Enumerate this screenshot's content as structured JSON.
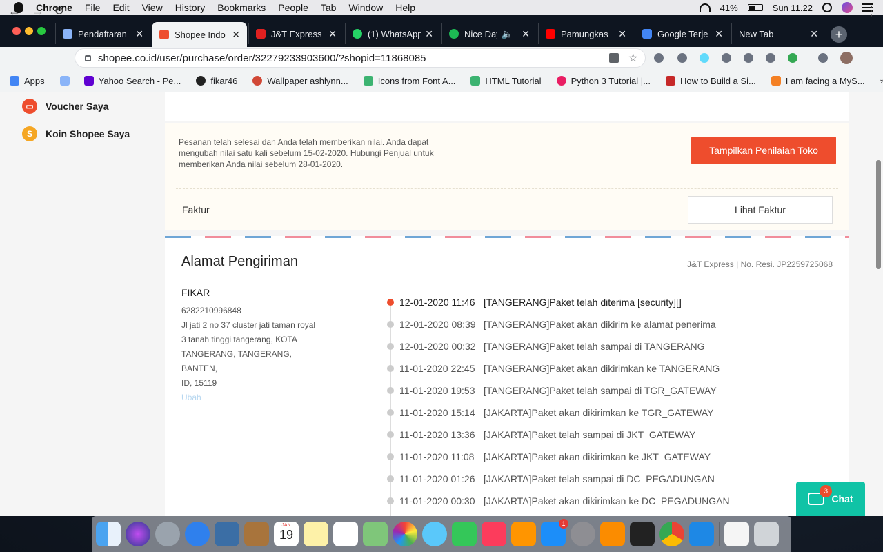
{
  "menubar": {
    "app": "Chrome",
    "menus": [
      "File",
      "Edit",
      "View",
      "History",
      "Bookmarks",
      "People",
      "Tab",
      "Window",
      "Help"
    ],
    "battery": "41%",
    "clock": "Sun 11.22"
  },
  "tabs": [
    {
      "title": "Pendaftaran",
      "color": "#8ab4f8"
    },
    {
      "title": "Shopee Indo",
      "color": "#ee4d2d"
    },
    {
      "title": "J&T Express",
      "color": "#e02020"
    },
    {
      "title": "(1) WhatsApp",
      "color": "#25d366"
    },
    {
      "title": "Nice Day",
      "color": "#1db954"
    },
    {
      "title": "Pamungkas",
      "color": "#ff0000"
    },
    {
      "title": "Google Terje",
      "color": "#4285f4"
    },
    {
      "title": "New Tab",
      "color": ""
    }
  ],
  "omnibox": {
    "url": "shopee.co.id/user/purchase/order/32279233903600/?shopid=11868085"
  },
  "bookmarks": [
    {
      "label": "Apps",
      "color": "#4285f4"
    },
    {
      "label": "",
      "color": "#8ab4f8"
    },
    {
      "label": "Yahoo Search - Pe...",
      "color": "#5f01d1"
    },
    {
      "label": "fikar46",
      "color": "#222"
    },
    {
      "label": "Wallpaper ashlynn...",
      "color": "#d14836"
    },
    {
      "label": "Icons from Font A...",
      "color": "#3cb371"
    },
    {
      "label": "HTML Tutorial",
      "color": "#3cb371"
    },
    {
      "label": "Python 3 Tutorial |...",
      "color": "#e91e63"
    },
    {
      "label": "How to Build a Si...",
      "color": "#c62828"
    },
    {
      "label": "I am facing a MyS...",
      "color": "#f48024"
    }
  ],
  "sidebar": {
    "items": [
      {
        "label": "Voucher Saya",
        "color": "#ee4d2d"
      },
      {
        "label": "Koin Shopee Saya",
        "color": "#f5a623"
      }
    ]
  },
  "notice": {
    "message": "Pesanan telah selesai dan Anda telah memberikan nilai. Anda dapat mengubah nilai satu kali sebelum 15-02-2020. Hubungi Penjual untuk memberikan Anda nilai sebelum 28-01-2020.",
    "rate_button": "Tampilkan Penilaian Toko",
    "invoice_label": "Faktur",
    "invoice_button": "Lihat Faktur"
  },
  "shipping": {
    "title": "Alamat Pengiriman",
    "courier": "J&T Express | No. Resi. JP2259725068",
    "name": "FIKAR",
    "phone": "6282210996848",
    "address": [
      "Jl jati 2 no 37 cluster jati taman royal",
      "3 tanah tinggi tangerang, KOTA",
      "TANGERANG, TANGERANG, BANTEN,",
      "ID, 15119"
    ],
    "edit": "Ubah",
    "timeline": [
      {
        "time": "12-01-2020 11:46",
        "text": "[TANGERANG]Paket telah diterima [security][]"
      },
      {
        "time": "12-01-2020 08:39",
        "text": "[TANGERANG]Paket akan dikirim ke alamat penerima"
      },
      {
        "time": "12-01-2020 00:32",
        "text": "[TANGERANG]Paket telah sampai di TANGERANG"
      },
      {
        "time": "11-01-2020 22:45",
        "text": "[TANGERANG]Paket akan dikirimkan ke TANGERANG"
      },
      {
        "time": "11-01-2020 19:53",
        "text": "[TANGERANG]Paket telah sampai di TGR_GATEWAY"
      },
      {
        "time": "11-01-2020 15:14",
        "text": "[JAKARTA]Paket akan dikirimkan ke TGR_GATEWAY"
      },
      {
        "time": "11-01-2020 13:36",
        "text": "[JAKARTA]Paket telah sampai di JKT_GATEWAY"
      },
      {
        "time": "11-01-2020 11:08",
        "text": "[JAKARTA]Paket akan dikirimkan ke JKT_GATEWAY"
      },
      {
        "time": "11-01-2020 01:26",
        "text": "[JAKARTA]Paket telah sampai di DC_PEGADUNGAN"
      },
      {
        "time": "11-01-2020 00:30",
        "text": "[JAKARTA]Paket akan dikirimkan ke DC_PEGADUNGAN"
      }
    ]
  },
  "chat": {
    "label": "Chat",
    "badge": "3"
  },
  "dock": {
    "calendar_month": "JAN",
    "calendar_day": "19",
    "appstore_badge": "1",
    "icons": [
      "finder-icon",
      "siri-icon",
      "launchpad-icon",
      "safari-icon",
      "eagle-icon",
      "notes-brown-icon",
      "calendar-icon",
      "notes-icon",
      "reminders-icon",
      "maps-icon",
      "photos-icon",
      "messages-icon",
      "facetime-icon",
      "music-icon",
      "books-icon",
      "appstore-icon",
      "settings-icon",
      "xampp-icon",
      "terminal-icon",
      "chrome-icon",
      "vscode-icon",
      "document-icon",
      "trash-icon"
    ]
  }
}
